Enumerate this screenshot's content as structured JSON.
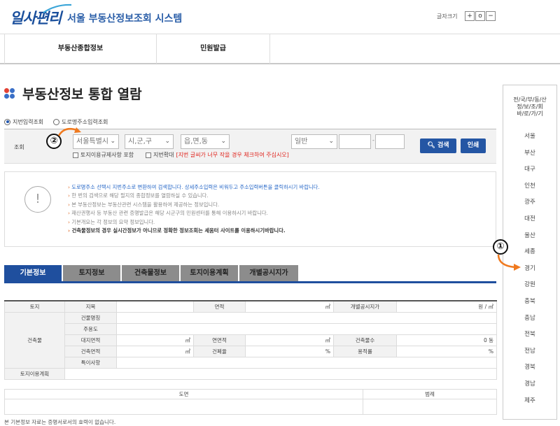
{
  "header": {
    "logo": "일사편리",
    "subtitle": "서울 부동산정보조회 시스템",
    "font_size_label": "글자크기",
    "font_buttons": [
      "+",
      "o",
      "−"
    ]
  },
  "nav": {
    "items": [
      "부동산종합정보",
      "민원발급"
    ]
  },
  "page": {
    "title": "부동산정보 통합 열람",
    "dot_colors": [
      "#e34234",
      "#3a6fc7",
      "#3a6fc7",
      "#3a6fc7"
    ]
  },
  "search_mode": {
    "jibun": "지번입력조회",
    "road": "도로명주소입력조회"
  },
  "search": {
    "label": "조회",
    "city": "서울특별시",
    "district": "시,군,구",
    "town": "읍,면,동",
    "land_type": "일반",
    "dash": "-",
    "search_button": "검색",
    "print_button": "인쇄",
    "check_land_use": "토지이용규제사항 포함",
    "check_enlarge": "지번확대",
    "enlarge_note": "[지번 글씨가 너무 작을 경우 체크하여 주십시오]"
  },
  "annotations": {
    "one": "①",
    "two": "②"
  },
  "notice": {
    "icon": "!",
    "lines": [
      "도로명주소 선택시 지번주소로 변환하여 검색합니다. 상세주소입력은 비워두고 주소입력버튼을 클릭하시기 바랍니다.",
      "한 번의 검색으로 해당 필지의 종합정보를 열람하실 수 있습니다.",
      "본 부동산정보는 부동산관련 시스템을 활용하여 제공하는 정보입니다.",
      "재산권행사 등 부동산 관련 증명발급은 해당 시군구의 민원센터를 통해 이용하시기 바랍니다.",
      "기본개요는 각 정보의 요약 정보입니다.",
      "건축물정보의 경우 실시간정보가 아니므로 정확한 정보조회는 세움터 사이트를 이용하시기바랍니다."
    ]
  },
  "tabs": [
    "기본정보",
    "토지정보",
    "건축물정보",
    "토지이용계획",
    "개별공시지가"
  ],
  "info_table": {
    "land": "토지",
    "jimok": "지목",
    "area": "면적",
    "area_unit": "㎡",
    "official_price": "개별공시지가",
    "price_unit": "원 / ㎡",
    "building": "건축물",
    "bldg_name": "건물명칭",
    "main_use": "주용도",
    "site_area": "대지면적",
    "floor_area": "연면적",
    "floors": "건축물수",
    "floors_value": "0 동",
    "building_area": "건축면적",
    "bcr": "건폐율",
    "far": "용적률",
    "pct": "%",
    "remarks": "특이사항",
    "land_use_plan": "토지이용계획"
  },
  "plan_table": {
    "map": "도면",
    "legend": "범례"
  },
  "footnote": "본 기본정보 자료는 증명서로서의 효력이 없습니다.",
  "sidebar": {
    "title_lines": [
      "전/국/부/동/산",
      "정/보/조/회",
      "바/로/가/기"
    ],
    "items": [
      "서울",
      "부산",
      "대구",
      "인천",
      "광주",
      "대전",
      "울산",
      "세종",
      "경기",
      "강원",
      "충북",
      "충남",
      "전북",
      "전남",
      "경북",
      "경남",
      "제주"
    ]
  },
  "colors": {
    "primary": "#1f4f9e",
    "annotation_arrow": "#f07a1f",
    "warning": "#e0261f"
  }
}
